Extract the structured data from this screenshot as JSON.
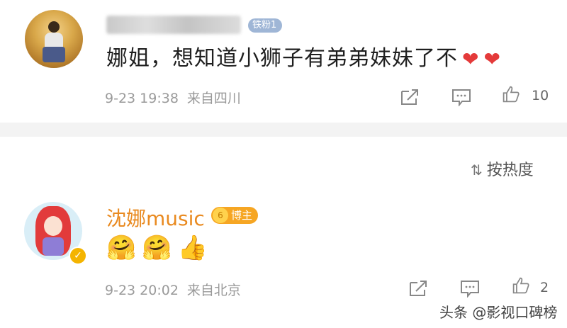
{
  "comment1": {
    "text": "娜姐，想知道小狮子有弟弟妹妹了不",
    "badge": "铁粉1",
    "hearts": [
      "❤",
      "❤"
    ],
    "time": "9-23 19:38",
    "location": "来自四川",
    "like_count": "10"
  },
  "sort": {
    "label": "按热度",
    "icon": "sort-icon"
  },
  "comment2": {
    "username": "沈娜music",
    "badge": "博主",
    "badge_level": "6",
    "emojis": [
      "🤗",
      "🤗",
      "👍"
    ],
    "time": "9-23 20:02",
    "location": "来自北京",
    "like_count": "2"
  },
  "watermark": "头条 @影视口碑榜",
  "colors": {
    "username": "#e98a20",
    "heart": "#e43a3a",
    "meta": "#9a9a9a",
    "divider": "#f3f3f3"
  }
}
